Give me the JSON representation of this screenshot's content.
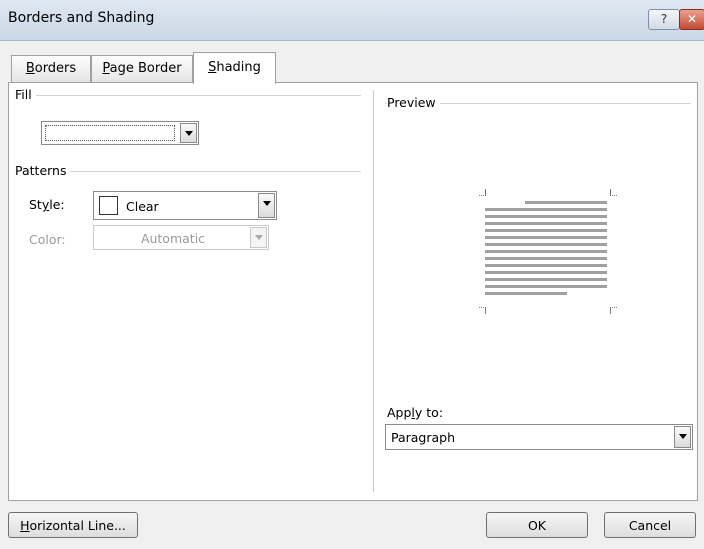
{
  "window": {
    "title": "Borders and Shading",
    "help_label": "?",
    "close_label": "✕"
  },
  "tabs": [
    {
      "label_pre": "",
      "label_key": "B",
      "label_post": "orders"
    },
    {
      "label_pre": "",
      "label_key": "P",
      "label_post": "age Border"
    },
    {
      "label_pre": "",
      "label_key": "S",
      "label_post": "hading"
    }
  ],
  "fill": {
    "group_label": "Fill",
    "value": ""
  },
  "patterns": {
    "group_label": "Patterns",
    "style_label_pre": "St",
    "style_label_key": "y",
    "style_label_post": "le:",
    "style_value": "Clear",
    "color_label": "Color:",
    "color_value": "Automatic"
  },
  "preview": {
    "group_label": "Preview"
  },
  "apply_to": {
    "label_pre": "App",
    "label_key": "l",
    "label_post": "y to:",
    "value": "Paragraph"
  },
  "buttons": {
    "horizontal_line_key": "H",
    "horizontal_line_post": "orizontal Line...",
    "ok": "OK",
    "cancel": "Cancel"
  },
  "colors": {
    "title_bar": "#cbd8e6",
    "panel_bg": "#ffffff",
    "preview_lines": "#a0a0a0"
  }
}
